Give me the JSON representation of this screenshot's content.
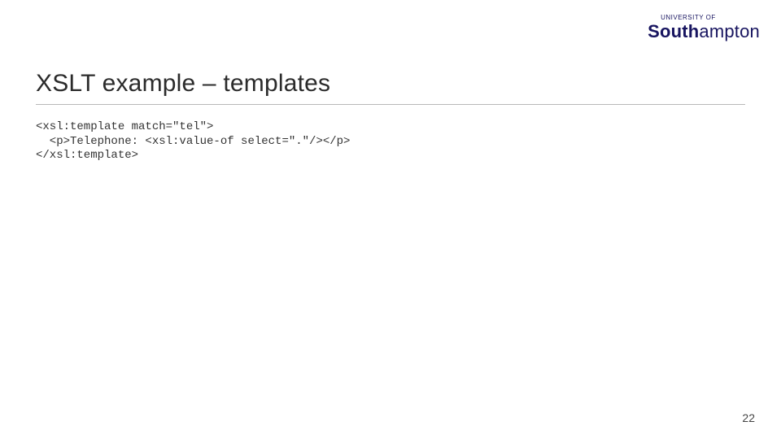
{
  "logo": {
    "university_of": "UNIVERSITY OF",
    "south": "South",
    "ampton": "ampton"
  },
  "title": "XSLT example – templates",
  "code": {
    "l1": "<xsl:template match=\"tel\">",
    "l2": "  <p>Telephone: <xsl:value-of select=\".\"/></p>",
    "l3": "</xsl:template>"
  },
  "page_number": "22"
}
